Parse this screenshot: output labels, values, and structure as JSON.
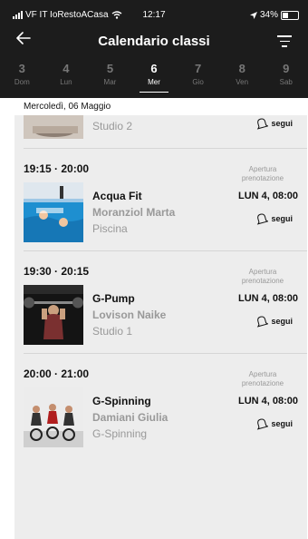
{
  "status": {
    "carrier": "VF IT IoRestoACasa",
    "time": "12:17",
    "battery": "34%",
    "battery_level": 0.34
  },
  "header": {
    "title": "Calendario classi"
  },
  "days": [
    {
      "num": "3",
      "label": "Dom"
    },
    {
      "num": "4",
      "label": "Lun"
    },
    {
      "num": "5",
      "label": "Mar"
    },
    {
      "num": "6",
      "label": "Mer",
      "active": true
    },
    {
      "num": "7",
      "label": "Gio"
    },
    {
      "num": "8",
      "label": "Ven"
    },
    {
      "num": "9",
      "label": "Sab"
    }
  ],
  "date_label": "Mercoledì, 06 Maggio",
  "partial_item": {
    "room": "Studio 2",
    "follow": "segui"
  },
  "classes": [
    {
      "time": "19:15 · 20:00",
      "name": "Acqua Fit",
      "teacher": "Moranziol Marta",
      "room": "Piscina",
      "booking_line1": "Apertura",
      "booking_line2": "prenotazione",
      "booking_datetime": "LUN 4, 08:00",
      "follow": "segui"
    },
    {
      "time": "19:30 · 20:15",
      "name": "G-Pump",
      "teacher": "Lovison  Naike",
      "room": "Studio 1",
      "booking_line1": "Apertura",
      "booking_line2": "prenotazione",
      "booking_datetime": "LUN 4, 08:00",
      "follow": "segui"
    },
    {
      "time": "20:00 · 21:00",
      "name": "G-Spinning",
      "teacher": "Damiani Giulia",
      "room": "G-Spinning",
      "booking_line1": "Apertura",
      "booking_line2": "prenotazione",
      "booking_datetime": "LUN 4, 08:00",
      "follow": "segui"
    }
  ]
}
